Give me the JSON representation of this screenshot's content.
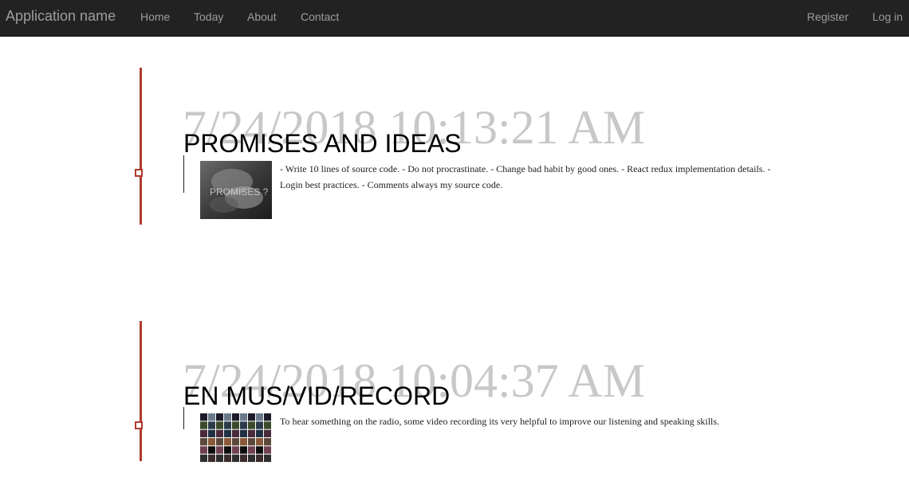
{
  "navbar": {
    "brand": "Application name",
    "left_links": [
      "Home",
      "Today",
      "About",
      "Contact"
    ],
    "right_links": [
      "Register",
      "Log in"
    ]
  },
  "posts": [
    {
      "timestamp": "7/24/2018 10:13:21 AM",
      "title": "PROMISES AND IDEAS",
      "thumbnail_text": "PROMISES ?",
      "text": "- Write 10 lines of source code. - Do not procrastinate. - Change bad habit by good ones. - React redux implementation details. - Login best practices. - Comments always my source code."
    },
    {
      "timestamp": "7/24/2018 10:04:37 AM",
      "title": "EN MUS/VID/RECORD",
      "text": "To hear something on the radio, some video recording its very helpful to improve our listening and speaking skills."
    }
  ],
  "colors": {
    "navbar_bg": "#222222",
    "nav_text": "#9d9d9d",
    "timeline_accent": "#b03a2e",
    "timestamp_text": "#c8c8c8"
  }
}
